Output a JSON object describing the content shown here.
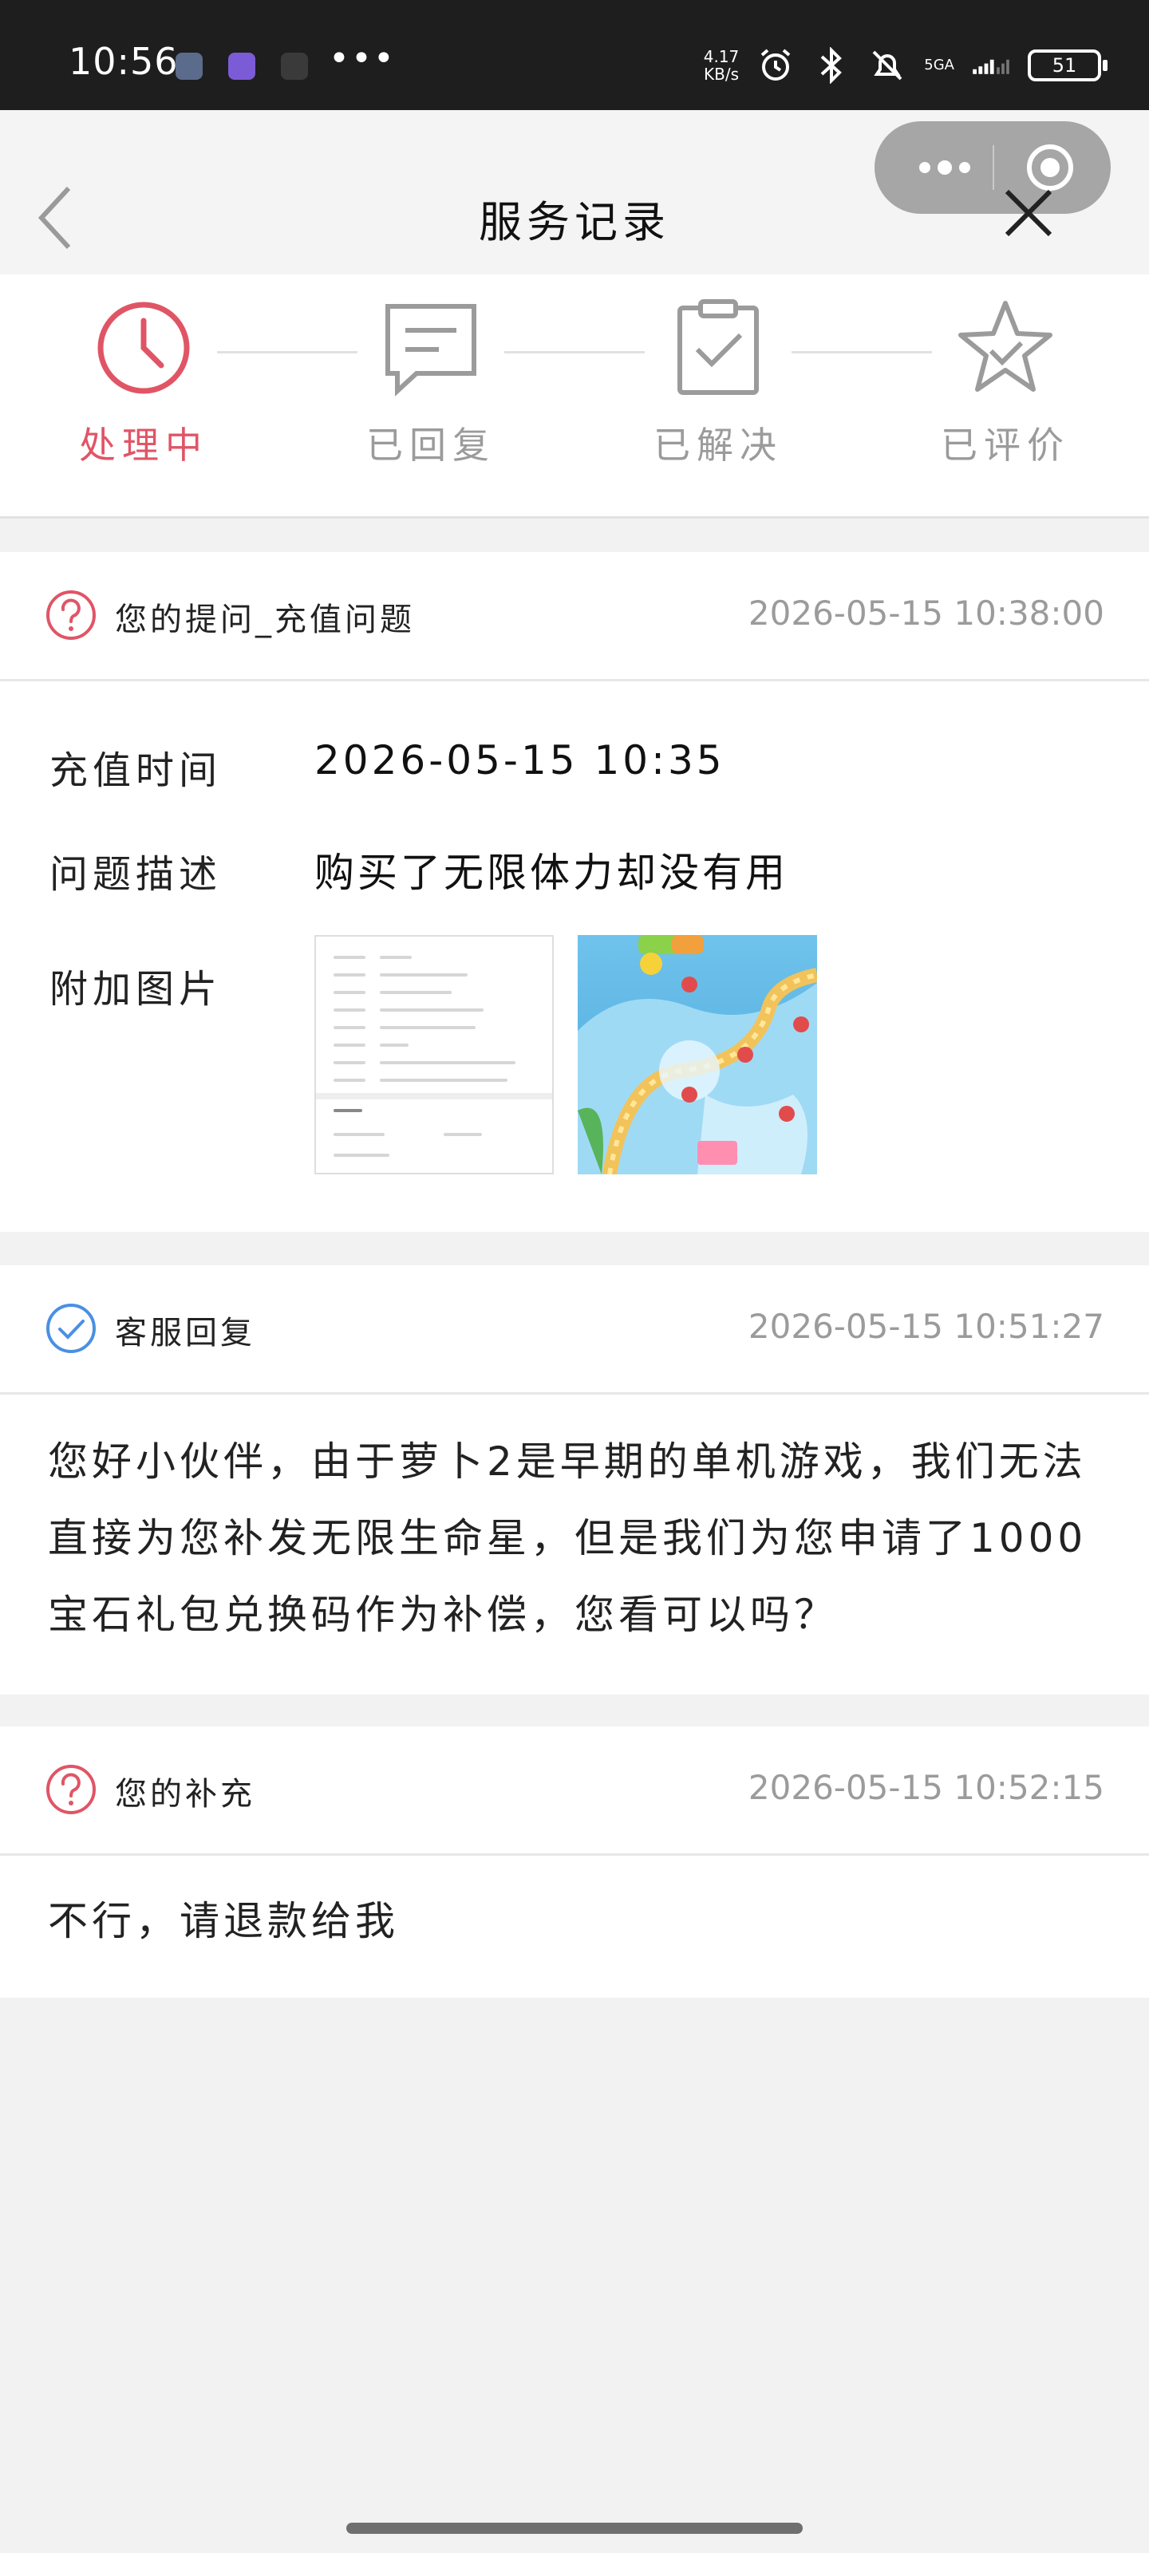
{
  "status_bar": {
    "time": "10:56",
    "more": "•••",
    "net_speed_value": "4.17",
    "net_speed_unit": "KB/s",
    "network": "5GA",
    "battery": "51"
  },
  "nav": {
    "title": "服务记录"
  },
  "steps": [
    {
      "label": "处理中",
      "active": true
    },
    {
      "label": "已回复",
      "active": false
    },
    {
      "label": "已解决",
      "active": false
    },
    {
      "label": "已评价",
      "active": false
    }
  ],
  "question": {
    "title": "您的提问_充值问题",
    "time": "2026-05-15 10:38:00",
    "recharge_time_label": "充值时间",
    "recharge_time_value": "2026-05-15 10:35",
    "desc_label": "问题描述",
    "desc_value": "购买了无限体力却没有用",
    "images_label": "附加图片"
  },
  "reply": {
    "title": "客服回复",
    "time": "2026-05-15 10:51:27",
    "text": "您好小伙伴，由于萝卜2是早期的单机游戏，我们无法直接为您补发无限生命星，但是我们为您申请了1000宝石礼包兑换码作为补偿，您看可以吗？"
  },
  "supplement": {
    "title": "您的补充",
    "time": "2026-05-15 10:52:15",
    "text": "不行，请退款给我"
  },
  "colors": {
    "accent_red": "#e05566",
    "reply_blue": "#4a90e2",
    "muted": "#9b9b9b"
  }
}
